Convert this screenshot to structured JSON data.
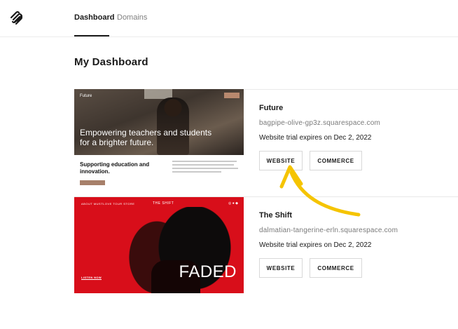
{
  "nav": {
    "logo_icon": "squarespace-logo-icon",
    "tabs": [
      {
        "label": "Dashboard",
        "active": true
      },
      {
        "label": "Domains",
        "active": false
      }
    ]
  },
  "page": {
    "title": "My Dashboard"
  },
  "sites": [
    {
      "name": "Future",
      "url": "bagpipe-olive-gp3z.squarespace.com",
      "trial": "Website trial expires on Dec 2, 2022",
      "website_button": "WEBSITE",
      "commerce_button": "COMMERCE",
      "thumbnail": {
        "brand": "Future",
        "headline": "Empowering teachers and students for a brighter future.",
        "subheading": "Supporting education and innovation."
      }
    },
    {
      "name": "The Shift",
      "url": "dalmatian-tangerine-erln.squarespace.com",
      "trial": "Website trial expires on Dec 2, 2022",
      "website_button": "WEBSITE",
      "commerce_button": "COMMERCE",
      "thumbnail": {
        "nav": "ABOUT   MUSTLOVE   TOUR   STORE",
        "title": "THE SHIFT",
        "headline": "FADED",
        "cta": "LISTEN NOW"
      }
    }
  ],
  "annotation": {
    "arrow_color": "#f5c400"
  },
  "colors": {
    "accent_red": "#d80e1a",
    "text": "#1a1a1a",
    "muted": "#7a7a7a"
  }
}
